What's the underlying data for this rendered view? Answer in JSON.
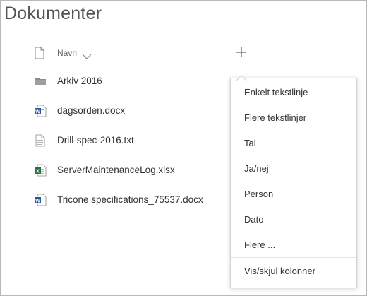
{
  "page": {
    "title": "Dokumenter"
  },
  "header": {
    "name_label": "Navn",
    "add_column_icon": "plus-icon",
    "sort_icon": "chevron-down-icon",
    "type_icon": "document-outline-icon"
  },
  "files": [
    {
      "name": "Arkiv 2016",
      "type": "folder",
      "icon": "folder-icon"
    },
    {
      "name": "dagsorden.docx",
      "type": "word",
      "icon": "word-document-icon"
    },
    {
      "name": "Drill-spec-2016.txt",
      "type": "text",
      "icon": "text-file-icon"
    },
    {
      "name": "ServerMaintenanceLog.xlsx",
      "type": "excel",
      "icon": "excel-document-icon"
    },
    {
      "name": "Tricone specifications_75537.docx",
      "type": "word",
      "icon": "word-document-icon"
    }
  ],
  "add_column_menu": {
    "items": [
      {
        "label": "Enkelt tekstlinje"
      },
      {
        "label": "Flere tekstlinjer"
      },
      {
        "label": "Tal"
      },
      {
        "label": "Ja/nej"
      },
      {
        "label": "Person"
      },
      {
        "label": "Dato"
      },
      {
        "label": "Flere ..."
      }
    ],
    "footer_label": "Vis/skjul kolonner"
  },
  "colors": {
    "word_blue": "#2b579a",
    "excel_green": "#217346",
    "folder_gray": "#8a8a8a",
    "text": "#333333"
  }
}
